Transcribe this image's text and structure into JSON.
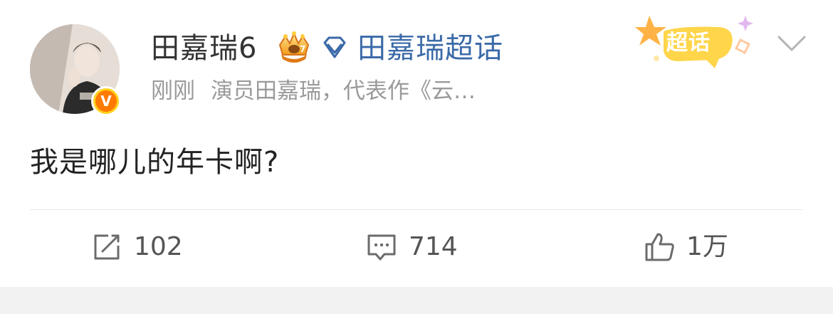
{
  "post": {
    "author": {
      "name": "田嘉瑞6",
      "verified_badge": "V",
      "level_icon": "crown-icon"
    },
    "topic": {
      "icon": "diamond-icon",
      "name": "田嘉瑞超话"
    },
    "meta": {
      "time": "刚刚",
      "description": "演员田嘉瑞，代表作《云…"
    },
    "badge": {
      "label": "超话"
    },
    "text": "我是哪儿的年卡啊?"
  },
  "actions": {
    "repost": {
      "icon": "share-edit-icon",
      "count": "102"
    },
    "comment": {
      "icon": "comment-icon",
      "count": "714"
    },
    "like": {
      "icon": "thumbs-up-icon",
      "count": "1万"
    }
  },
  "colors": {
    "topic_link": "#3b6aa8",
    "verified_outer": "#ffd21f",
    "verified_inner": "#ff7a00",
    "chaohua_badge": "#ffd54a"
  }
}
